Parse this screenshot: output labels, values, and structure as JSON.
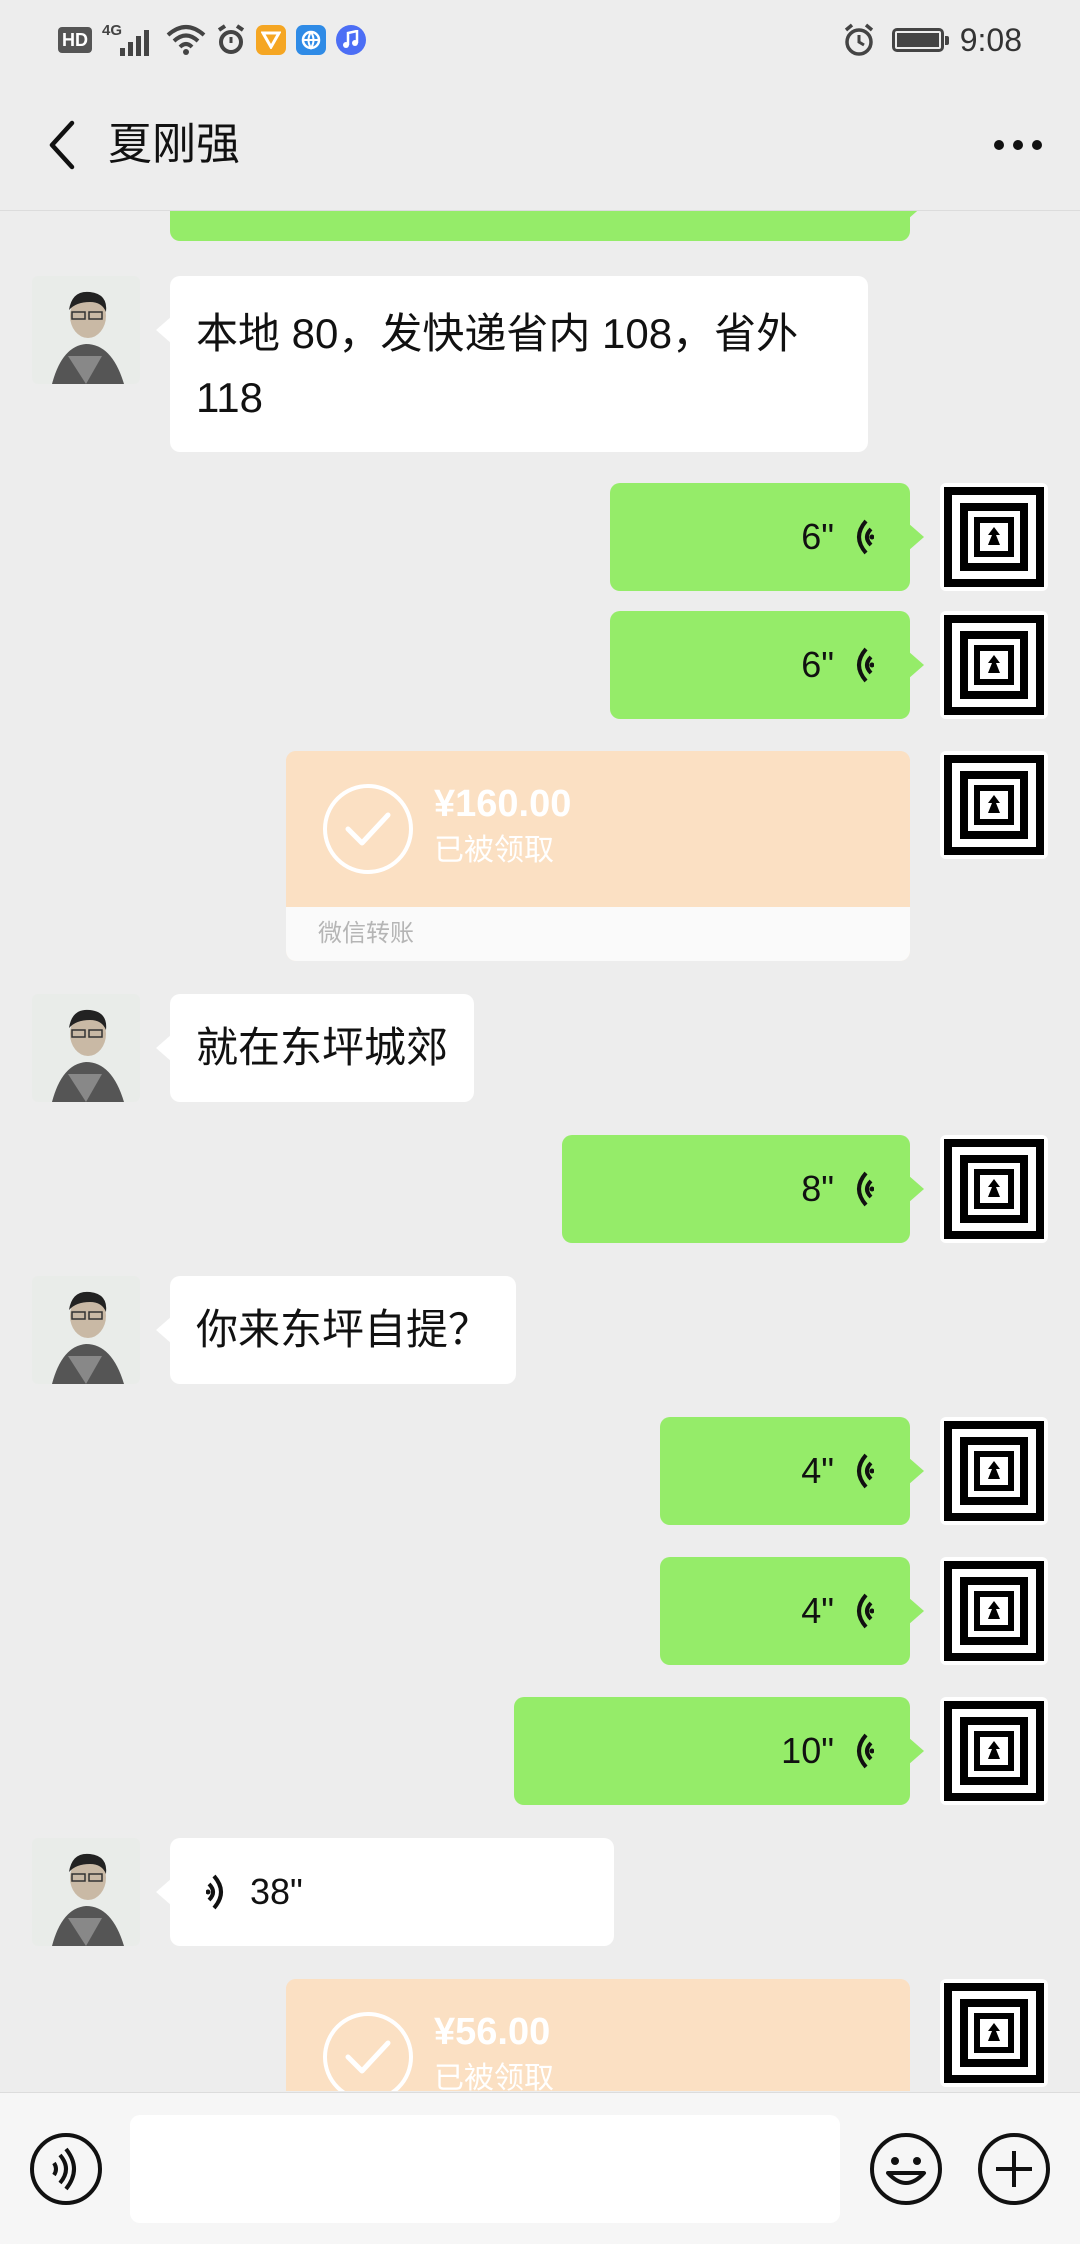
{
  "status_bar": {
    "hd": "HD",
    "network": "4G",
    "time": "9:08"
  },
  "nav": {
    "title": "夏刚强"
  },
  "messages": [
    {
      "type": "text_in",
      "text_line1": "本地 80，发快递省内 108，省外",
      "text_line2": "118"
    },
    {
      "type": "voice_out",
      "duration": "6\""
    },
    {
      "type": "voice_out",
      "duration": "6\""
    },
    {
      "type": "transfer_out",
      "amount": "¥160.00",
      "status": "已被领取",
      "label": "微信转账"
    },
    {
      "type": "text_in",
      "text": "就在东坪城郊"
    },
    {
      "type": "voice_out",
      "duration": "8\""
    },
    {
      "type": "text_in",
      "text": "你来东坪自提？"
    },
    {
      "type": "voice_out",
      "duration": "4\""
    },
    {
      "type": "voice_out",
      "duration": "4\""
    },
    {
      "type": "voice_out",
      "duration": "10\""
    },
    {
      "type": "voice_in",
      "duration": "38\""
    },
    {
      "type": "transfer_out",
      "amount": "¥56.00",
      "status": "已被领取"
    }
  ],
  "input_bar": {
    "value": ""
  },
  "colors": {
    "bubble_out": "#95ec69",
    "bubble_in": "#ffffff",
    "transfer": "#fbe0c3",
    "background": "#ededed"
  }
}
